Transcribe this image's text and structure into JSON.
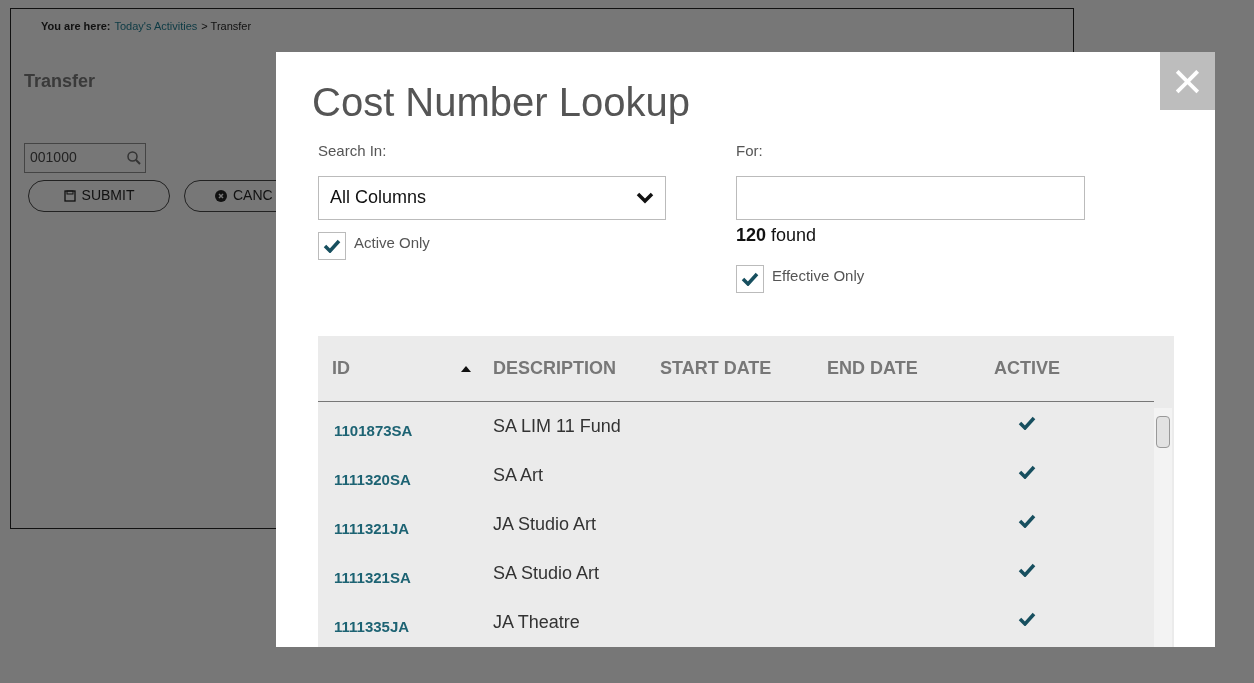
{
  "background_page": {
    "breadcrumb": {
      "label": "You are here:",
      "link": "Today's Activities",
      "current": "> Transfer"
    },
    "title": "Transfer",
    "cost_field": {
      "value": "001000"
    },
    "buttons": [
      {
        "kind": "submit",
        "label": "SUBMIT"
      },
      {
        "kind": "cancel",
        "label": "CANC"
      }
    ]
  },
  "modal": {
    "title": "Cost Number Lookup",
    "close": "×",
    "search_in": {
      "label": "Search In:",
      "value": "All Columns"
    },
    "for": {
      "label": "For:"
    },
    "found": "**120** found",
    "active_only": {
      "label": "Active Only",
      "checked": true
    },
    "effective_only": {
      "label": "Effective Only",
      "checked": true
    },
    "table": {
      "columns": [
        {
          "label": "ID",
          "sorted": true
        },
        {
          "label": "DESCRIPTION",
          "sorted": false
        },
        {
          "label": "START DATE",
          "sorted": false
        },
        {
          "label": "END DATE",
          "sorted": false
        },
        {
          "label": "ACTIVE",
          "sorted": false
        }
      ],
      "rows": [
        {
          "id": "1101873SA",
          "description": "SA LIM 11 Fund",
          "active": true
        },
        {
          "id": "1111320SA",
          "description": "SA Art",
          "active": true
        },
        {
          "id": "1111321JA",
          "description": "JA Studio Art",
          "active": true
        },
        {
          "id": "1111321SA",
          "description": "SA Studio Art",
          "active": true
        },
        {
          "id": "1111335JA",
          "description": "JA Theatre",
          "active": true
        }
      ]
    }
  }
}
